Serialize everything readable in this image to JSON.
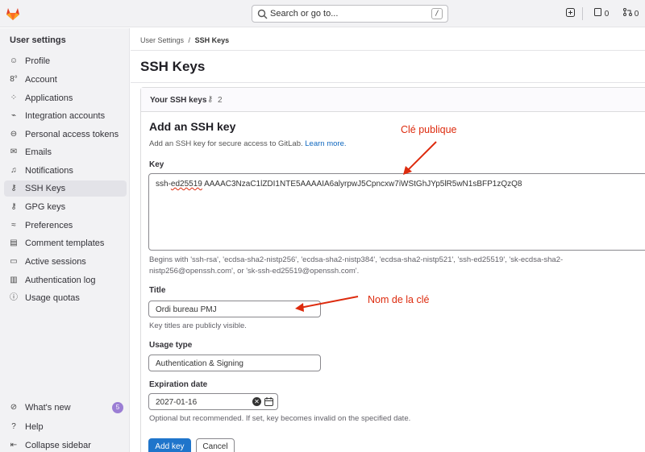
{
  "topbar": {
    "search_placeholder": "Search or go to...",
    "search_shortcut": "/",
    "issues_count": "0",
    "merge_requests_count": "0"
  },
  "sidebar": {
    "title": "User settings",
    "items": [
      {
        "label": "Profile",
        "icon": "profile-icon"
      },
      {
        "label": "Account",
        "icon": "account-icon"
      },
      {
        "label": "Applications",
        "icon": "applications-icon"
      },
      {
        "label": "Integration accounts",
        "icon": "integration-icon"
      },
      {
        "label": "Personal access tokens",
        "icon": "token-icon"
      },
      {
        "label": "Emails",
        "icon": "email-icon"
      },
      {
        "label": "Notifications",
        "icon": "bell-icon"
      },
      {
        "label": "SSH Keys",
        "icon": "key-icon",
        "active": true
      },
      {
        "label": "GPG keys",
        "icon": "key-icon"
      },
      {
        "label": "Preferences",
        "icon": "preferences-icon"
      },
      {
        "label": "Comment templates",
        "icon": "comment-icon"
      },
      {
        "label": "Active sessions",
        "icon": "monitor-icon"
      },
      {
        "label": "Authentication log",
        "icon": "log-icon"
      },
      {
        "label": "Usage quotas",
        "icon": "info-icon"
      }
    ],
    "footer": {
      "whats_new": "What's new",
      "whats_new_badge": "5",
      "help": "Help",
      "collapse": "Collapse sidebar"
    }
  },
  "breadcrumb": {
    "parent": "User Settings",
    "separator": "/",
    "current": "SSH Keys"
  },
  "page": {
    "title": "SSH Keys",
    "your_keys_label": "Your SSH keys",
    "your_keys_count": "2"
  },
  "form": {
    "heading": "Add an SSH key",
    "description": "Add an SSH key for secure access to GitLab.",
    "learn_more": "Learn more.",
    "key_label": "Key",
    "key_value_prefix": "ssh-",
    "key_value_squiggle": "ed25519",
    "key_value_rest": " AAAAC3NzaC1lZDI1NTE5AAAAIA6alyrpwJ5Cpncxw7iWStGhJYp5lR5wN1sBFP1zQzQ8",
    "key_help_line1": "Begins with 'ssh-rsa', 'ecdsa-sha2-nistp256', 'ecdsa-sha2-nistp384', 'ecdsa-sha2-nistp521', 'ssh-ed25519', 'sk-ecdsa-sha2-",
    "key_help_line2": "nistp256@openssh.com', or 'sk-ssh-ed25519@openssh.com'.",
    "title_label": "Title",
    "title_value": "Ordi bureau PMJ",
    "title_help": "Key titles are publicly visible.",
    "usage_label": "Usage type",
    "usage_value": "Authentication & Signing",
    "expiration_label": "Expiration date",
    "expiration_value": "2027-01-16",
    "expiration_help": "Optional but recommended. If set, key becomes invalid on the specified date.",
    "add_button": "Add key",
    "cancel_button": "Cancel"
  },
  "annotations": {
    "public_key": "Clé publique",
    "key_name": "Nom de la clé",
    "color": "#dd2b0e"
  }
}
